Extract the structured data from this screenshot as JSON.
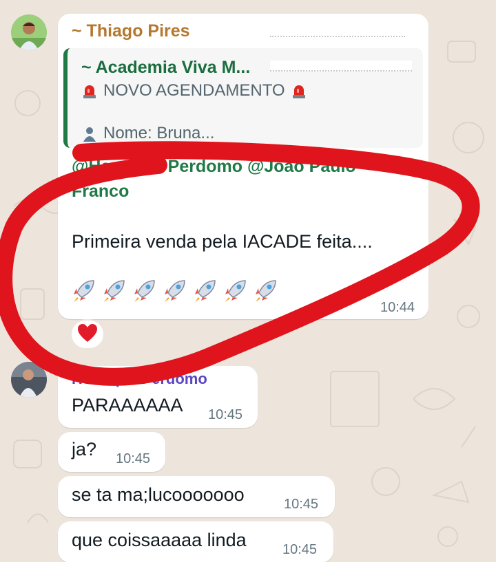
{
  "messages": {
    "thiago": {
      "sender": "~ Thiago Pires",
      "quoted": {
        "sender": "~ Academia Viva M...",
        "title": "NOVO AGENDAMENTO",
        "line": "Nome: Bruna..."
      },
      "mention_line1": "@Henrique Perdomo @João Paulo",
      "mention_line2": "Franco",
      "text": "Primeira venda pela IACADE feita....",
      "emoji": "🚀🚀🚀🚀🚀🚀🚀",
      "time": "10:44",
      "reaction": "❤️"
    },
    "henrique": [
      {
        "sender": "Henrique Perdomo",
        "text": "PARAAAAAA",
        "time": "10:45"
      },
      {
        "text": "ja?",
        "time": "10:45"
      },
      {
        "text": "se ta ma;lucooooooo",
        "time": "10:45"
      },
      {
        "text": "que coissaaaaa linda",
        "time": "10:45"
      }
    ]
  },
  "colors": {
    "wallpaper": "#ede5dc",
    "bubble": "#ffffff",
    "thiago_name": "#b5782f",
    "quote_accent": "#1f7a46",
    "henrique_name": "#5b45c4",
    "annotation_red": "#e0141c"
  }
}
